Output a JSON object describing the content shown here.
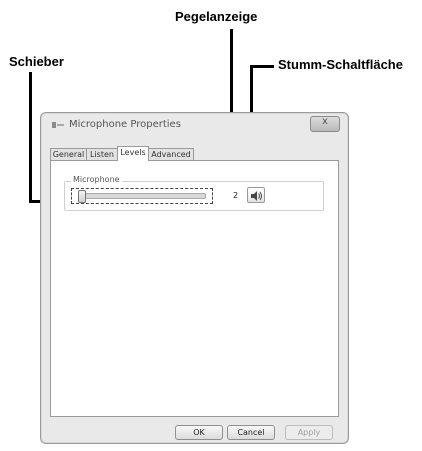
{
  "callouts": {
    "level": "Pegelanzeige",
    "slider": "Schieber",
    "mute": "Stumm-Schaltfläche"
  },
  "window": {
    "title": "Microphone Properties",
    "close": "x"
  },
  "tabs": [
    {
      "label": "General",
      "active": false
    },
    {
      "label": "Listen",
      "active": false
    },
    {
      "label": "Levels",
      "active": true
    },
    {
      "label": "Advanced",
      "active": false
    }
  ],
  "levels": {
    "group_label": "Microphone",
    "value": "2",
    "slider_fraction": 0.02
  },
  "buttons": {
    "ok": "OK",
    "cancel": "Cancel",
    "apply": "Apply"
  }
}
